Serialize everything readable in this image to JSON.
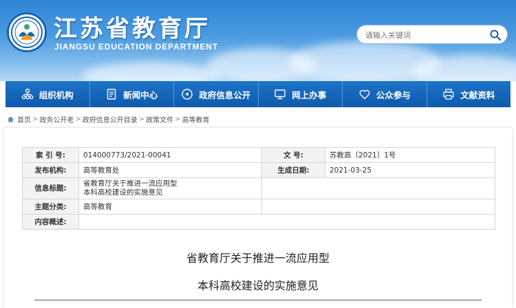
{
  "header": {
    "title": "江苏省教育厅",
    "subtitle": "JIANGSU EDUCATION DEPARTMENT",
    "search_placeholder": "请输入关键词",
    "colors": {
      "brand_blue": "#0f5aab",
      "sky": "#4b9be0"
    }
  },
  "nav": {
    "items": [
      {
        "label": "组织机构",
        "icon": "org-chart-icon"
      },
      {
        "label": "新闻中心",
        "icon": "document-icon"
      },
      {
        "label": "政府信息公开",
        "icon": "info-disclosure-icon"
      },
      {
        "label": "网上办事",
        "icon": "monitor-icon"
      },
      {
        "label": "公众参与",
        "icon": "heart-icon"
      },
      {
        "label": "文献资料",
        "icon": "printer-icon"
      }
    ]
  },
  "breadcrumb": [
    "首页",
    "政务公开老",
    "政府信息公开目录",
    "政策文件",
    "高等教育"
  ],
  "meta": {
    "index_label": "索 引 号:",
    "index_value": "014000773/2021-00041",
    "docno_label": "文    号:",
    "docno_value": "苏教高〔2021〕1号",
    "publisher_label": "发布机构:",
    "publisher_value": "高等教育处",
    "date_label": "生成日期:",
    "date_value": "2021-03-25",
    "title_label": "信息标题:",
    "title_value_line1": "省教育厅关于推进一流应用型",
    "title_value_line2": "本科高校建设的实施意见",
    "category_label": "主题分类:",
    "category_value": "高等教育",
    "summary_label": "内容概述:",
    "summary_value": ""
  },
  "document": {
    "title_line1": "省教育厅关于推进一流应用型",
    "title_line2": "本科高校建设的实施意见"
  }
}
